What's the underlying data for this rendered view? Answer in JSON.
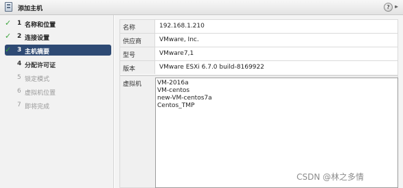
{
  "window": {
    "title": "添加主机",
    "help_label": "?",
    "forward_label": "▸▸"
  },
  "nav": {
    "items": [
      {
        "num": "1",
        "label": "名称和位置",
        "state": "done"
      },
      {
        "num": "2",
        "label": "连接设置",
        "state": "done"
      },
      {
        "num": "3",
        "label": "主机摘要",
        "state": "active"
      },
      {
        "num": "4",
        "label": "分配许可证",
        "state": "next"
      },
      {
        "num": "5",
        "label": "锁定模式",
        "state": "disabled"
      },
      {
        "num": "6",
        "label": "虚拟机位置",
        "state": "disabled"
      },
      {
        "num": "7",
        "label": "即将完成",
        "state": "disabled"
      }
    ],
    "check_glyph": "✓"
  },
  "summary": {
    "rows": [
      {
        "key": "名称",
        "value": "192.168.1.210"
      },
      {
        "key": "供应商",
        "value": "VMware, Inc."
      },
      {
        "key": "型号",
        "value": "VMware7,1"
      },
      {
        "key": "版本",
        "value": "VMware ESXi 6.7.0 build-8169922"
      }
    ],
    "vm_label": "虚拟机",
    "vms": [
      "VM-2016a",
      "VM-centos",
      "new-VM-centos7a",
      "Centos_TMP"
    ]
  },
  "watermark": "CSDN @林之多情",
  "colors": {
    "active_nav": "#2e4a74",
    "check": "#3aa33a"
  }
}
